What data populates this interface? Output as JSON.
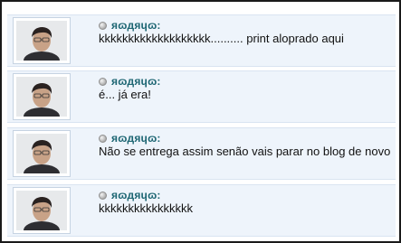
{
  "comments": [
    {
      "author": "яɷдяɥɷ:",
      "text": "kkkkkkkkkkkkkkkkkkk.......... print aloprado aqui"
    },
    {
      "author": "яɷдяɥɷ:",
      "text": "é... já era!"
    },
    {
      "author": "яɷдяɥɷ:",
      "text": "Não se entrega assim senão vais parar no blog de novo"
    },
    {
      "author": "яɷдяɥɷ:",
      "text": "kkkkkkkkkkkkkkkk"
    }
  ]
}
